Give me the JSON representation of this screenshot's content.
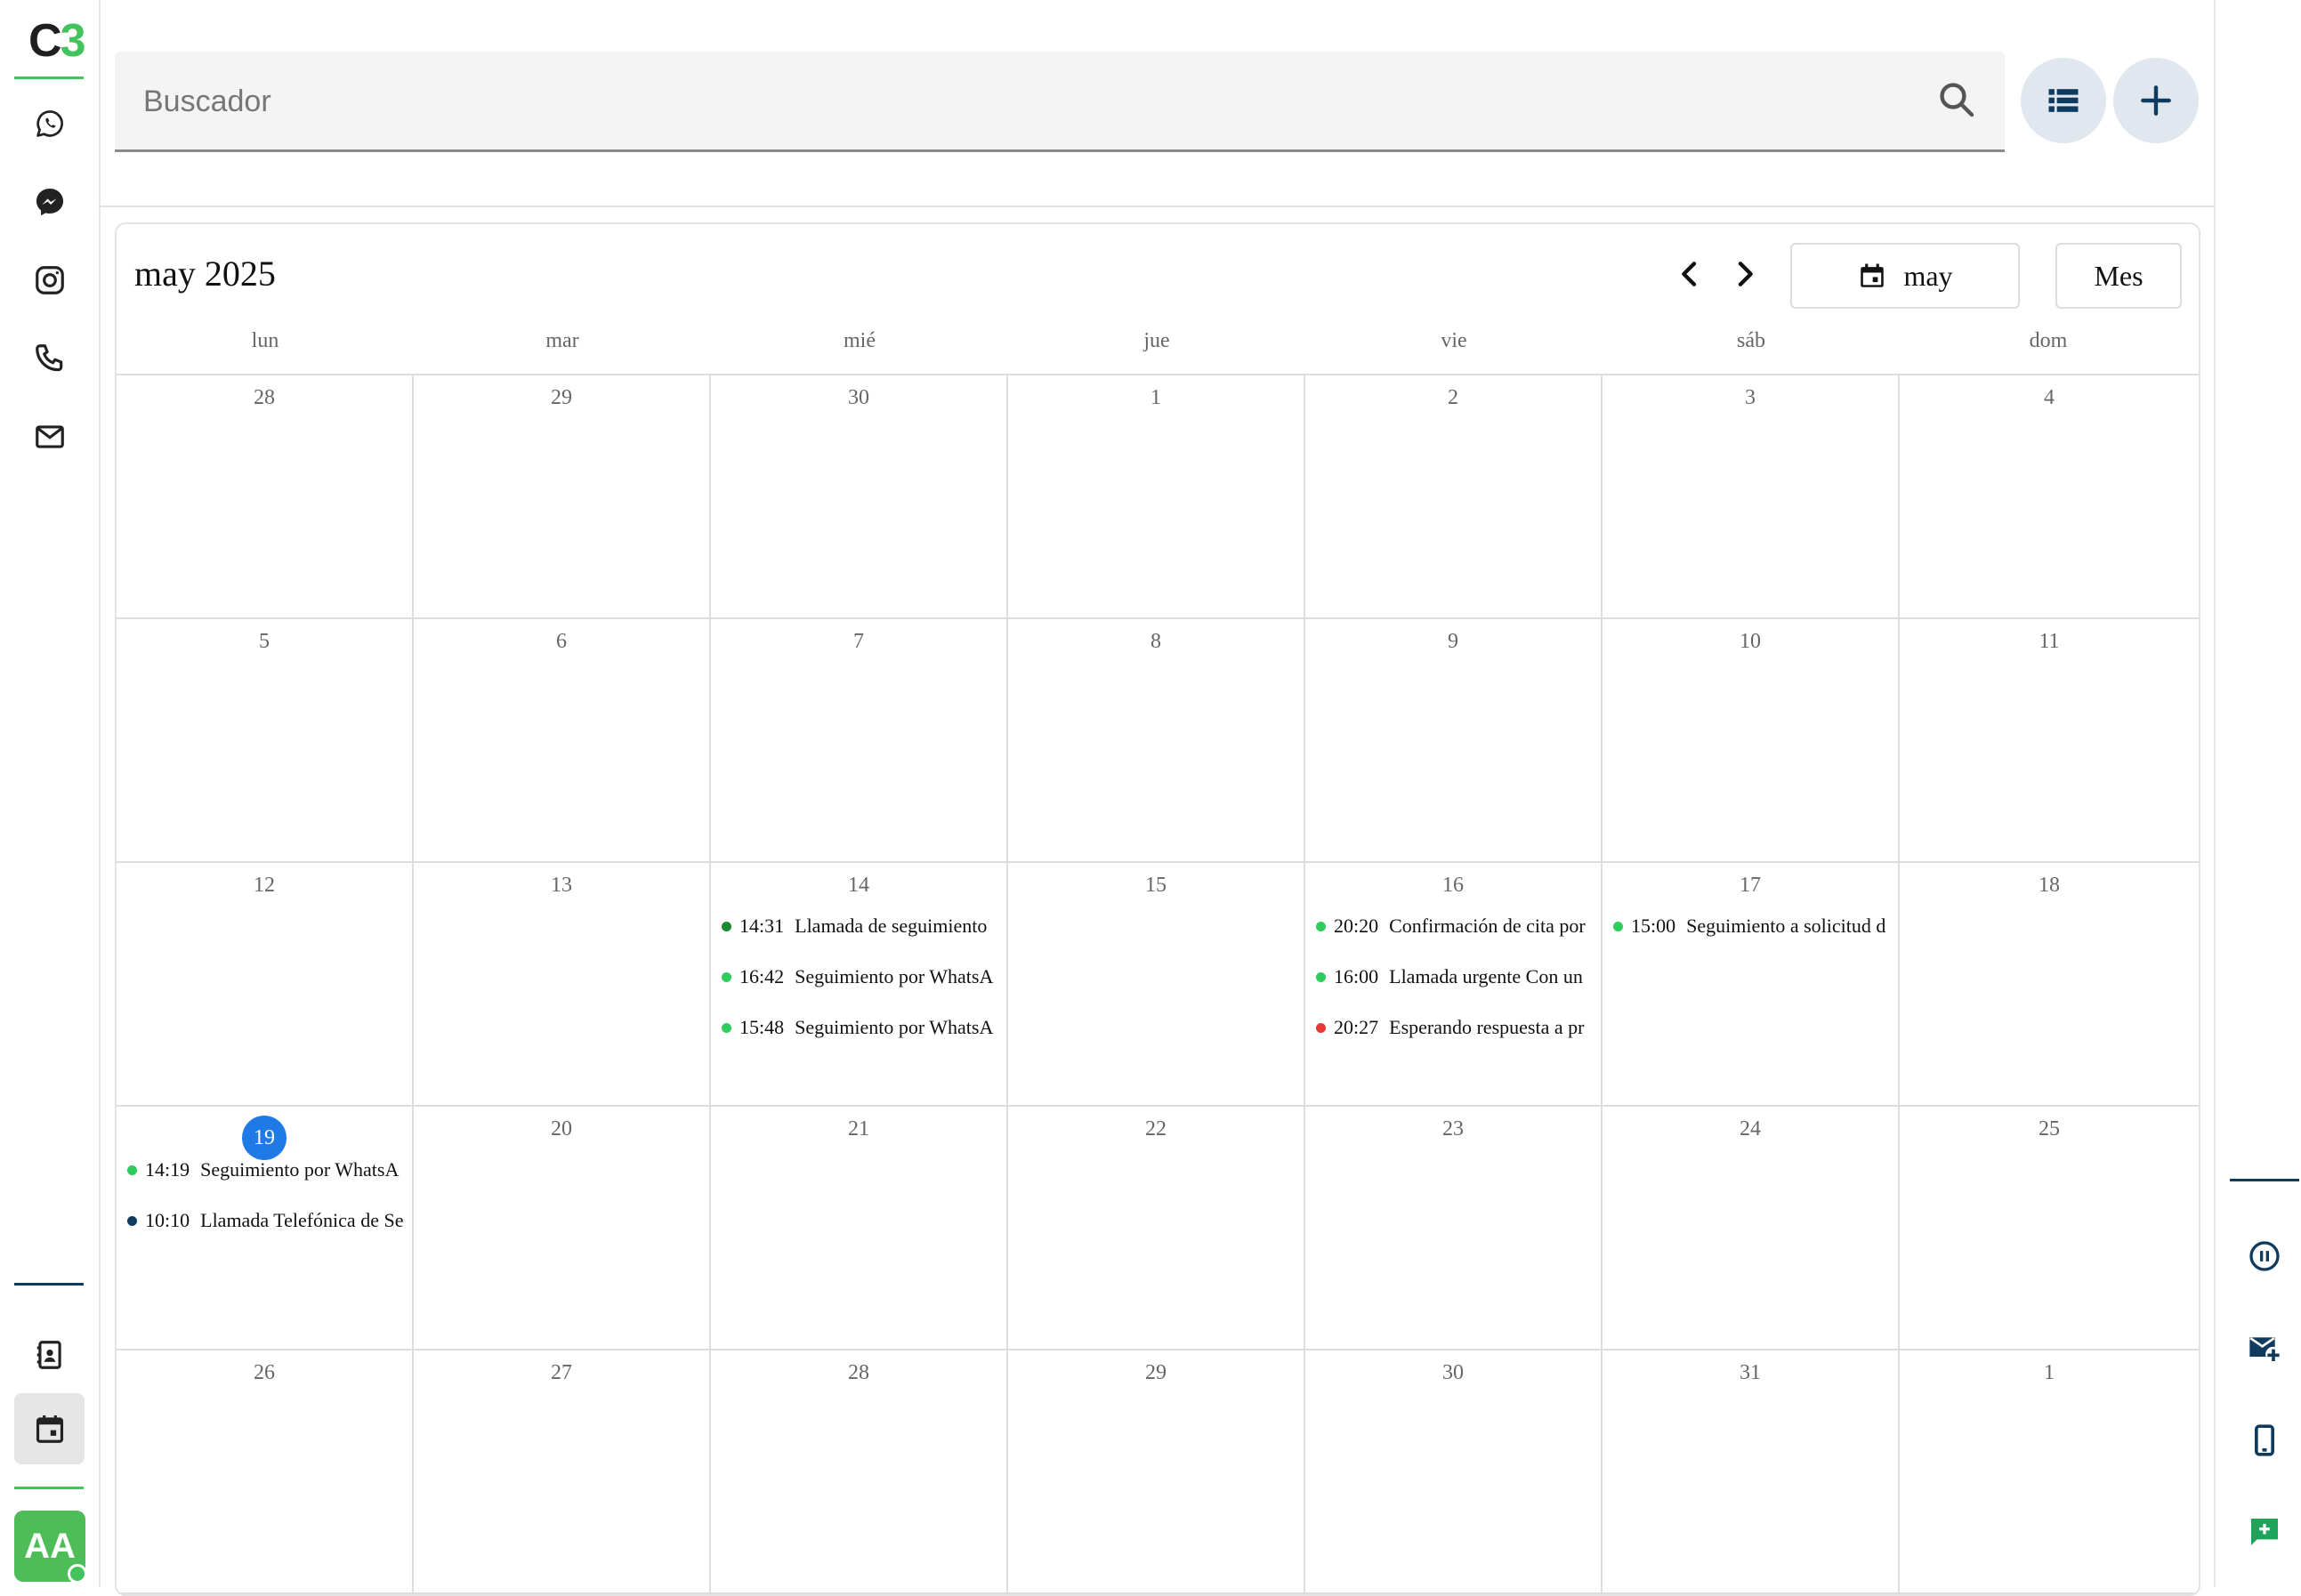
{
  "brand": {
    "logo_c": "C",
    "logo_n": "3"
  },
  "user": {
    "initials": "AA"
  },
  "sidebar": {
    "icons": [
      "whatsapp-icon",
      "messenger-icon",
      "instagram-icon",
      "phone-icon",
      "mail-icon",
      "contacts-icon",
      "calendar-icon"
    ]
  },
  "search": {
    "placeholder": "Buscador",
    "value": ""
  },
  "calendar": {
    "title": "may 2025",
    "month_button": "may",
    "view_button": "Mes",
    "weekdays": [
      "lun",
      "mar",
      "mié",
      "jue",
      "vie",
      "sáb",
      "dom"
    ],
    "weeks": [
      [
        {
          "day": "28",
          "events": []
        },
        {
          "day": "29",
          "events": []
        },
        {
          "day": "30",
          "events": []
        },
        {
          "day": "1",
          "events": []
        },
        {
          "day": "2",
          "events": []
        },
        {
          "day": "3",
          "events": []
        },
        {
          "day": "4",
          "events": []
        }
      ],
      [
        {
          "day": "5",
          "events": []
        },
        {
          "day": "6",
          "events": []
        },
        {
          "day": "7",
          "events": []
        },
        {
          "day": "8",
          "events": []
        },
        {
          "day": "9",
          "events": []
        },
        {
          "day": "10",
          "events": []
        },
        {
          "day": "11",
          "events": []
        }
      ],
      [
        {
          "day": "12",
          "events": []
        },
        {
          "day": "13",
          "events": []
        },
        {
          "day": "14",
          "events": [
            {
              "time": "14:31",
              "title": "Llamada de seguimiento",
              "color": "#1e8a2e"
            },
            {
              "time": "16:42",
              "title": "Seguimiento por WhatsA",
              "color": "#2ecc5c"
            },
            {
              "time": "15:48",
              "title": "Seguimiento por WhatsA",
              "color": "#2ecc5c"
            }
          ]
        },
        {
          "day": "15",
          "events": []
        },
        {
          "day": "16",
          "events": [
            {
              "time": "20:20",
              "title": "Confirmación de cita por",
              "color": "#2ecc5c"
            },
            {
              "time": "16:00",
              "title": "Llamada urgente Con un",
              "color": "#2ecc5c"
            },
            {
              "time": "20:27",
              "title": "Esperando respuesta a pr",
              "color": "#e53935"
            }
          ]
        },
        {
          "day": "17",
          "events": [
            {
              "time": "15:00",
              "title": "Seguimiento a solicitud d",
              "color": "#2ecc5c"
            }
          ]
        },
        {
          "day": "18",
          "events": []
        }
      ],
      [
        {
          "day": "19",
          "today": true,
          "events": [
            {
              "time": "14:19",
              "title": "Seguimiento por WhatsA",
              "color": "#2ecc5c"
            },
            {
              "time": "10:10",
              "title": "Llamada Telefónica de Se",
              "color": "#0f3b5f"
            }
          ]
        },
        {
          "day": "20",
          "events": []
        },
        {
          "day": "21",
          "events": []
        },
        {
          "day": "22",
          "events": []
        },
        {
          "day": "23",
          "events": []
        },
        {
          "day": "24",
          "events": []
        },
        {
          "day": "25",
          "events": []
        }
      ],
      [
        {
          "day": "26",
          "events": []
        },
        {
          "day": "27",
          "events": []
        },
        {
          "day": "28",
          "events": []
        },
        {
          "day": "29",
          "events": []
        },
        {
          "day": "30",
          "events": []
        },
        {
          "day": "31",
          "events": []
        },
        {
          "day": "1",
          "events": []
        }
      ]
    ]
  },
  "colors": {
    "brand_green": "#43c35b",
    "today_blue": "#1f7ae8",
    "navy": "#0f3b5f"
  }
}
